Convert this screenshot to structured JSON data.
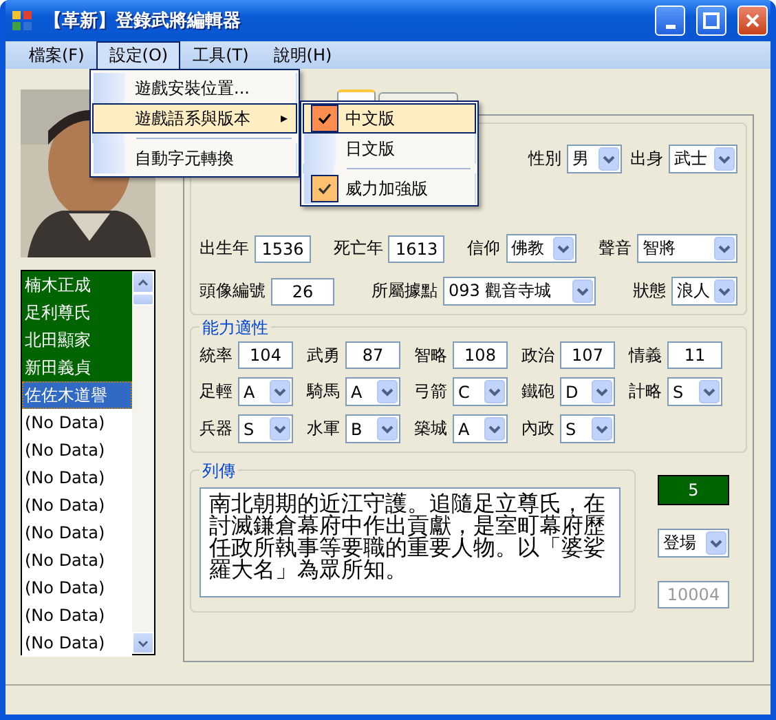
{
  "window": {
    "title": "【革新】登錄武將編輯器"
  },
  "menu": [
    {
      "label": "檔案(F)",
      "selected": false
    },
    {
      "label": "設定(O)",
      "selected": true
    },
    {
      "label": "工具(T)",
      "selected": false
    },
    {
      "label": "說明(H)",
      "selected": false
    }
  ],
  "dropdown": [
    {
      "kind": "item",
      "label": "遊戲安裝位置...",
      "selected": false
    },
    {
      "kind": "submenu",
      "label": "遊戲語系與版本",
      "arrow": "▸",
      "selected": true
    },
    {
      "kind": "separator"
    },
    {
      "kind": "item",
      "label": "自動字元轉換",
      "selected": false
    }
  ],
  "submenu": [
    {
      "kind": "item",
      "label": "中文版",
      "checked": true,
      "selected": true
    },
    {
      "kind": "item",
      "label": "日文版",
      "checked": false,
      "selected": false
    },
    {
      "kind": "separator"
    },
    {
      "kind": "item",
      "label": "威力加強版",
      "checked": true,
      "selected": false
    }
  ],
  "tabs": [
    {
      "selected": true
    },
    {
      "selected": false
    }
  ],
  "officers": [
    {
      "name": "楠木正成",
      "marked": true,
      "selected": false
    },
    {
      "name": "足利尊氏",
      "marked": true,
      "selected": false
    },
    {
      "name": "北田顯家",
      "marked": true,
      "selected": false
    },
    {
      "name": "新田義貞",
      "marked": true,
      "selected": false
    },
    {
      "name": "佐佐木道譽",
      "marked": false,
      "selected": true
    },
    {
      "name": "(No Data)",
      "marked": false,
      "selected": false
    },
    {
      "name": "(No Data)",
      "marked": false,
      "selected": false
    },
    {
      "name": "(No Data)",
      "marked": false,
      "selected": false
    },
    {
      "name": "(No Data)",
      "marked": false,
      "selected": false
    },
    {
      "name": "(No Data)",
      "marked": false,
      "selected": false
    },
    {
      "name": "(No Data)",
      "marked": false,
      "selected": false
    },
    {
      "name": "(No Data)",
      "marked": false,
      "selected": false
    },
    {
      "name": "(No Data)",
      "marked": false,
      "selected": false
    },
    {
      "name": "(No Data)",
      "marked": false,
      "selected": false
    }
  ],
  "basic": [
    [
      {
        "kind": "select",
        "label": "性別",
        "value": "男"
      },
      {
        "kind": "select",
        "label": "出身",
        "value": "武士"
      }
    ],
    [
      {
        "kind": "text",
        "label": "出生年",
        "value": "1536"
      },
      {
        "kind": "text",
        "label": "死亡年",
        "value": "1613"
      },
      {
        "kind": "select",
        "label": "信仰",
        "value": "佛教"
      },
      {
        "kind": "select",
        "label": "聲音",
        "value": "智將"
      }
    ],
    [
      {
        "kind": "text",
        "label": "頭像編號",
        "value": "26"
      },
      {
        "kind": "select",
        "label": "所屬據點",
        "value": "093 觀音寺城"
      },
      {
        "kind": "select",
        "label": "狀態",
        "value": "浪人"
      }
    ]
  ],
  "ability": {
    "title": "能力適性",
    "rows": [
      [
        {
          "kind": "text",
          "label": "統率",
          "value": "104"
        },
        {
          "kind": "text",
          "label": "武勇",
          "value": "87"
        },
        {
          "kind": "text",
          "label": "智略",
          "value": "108"
        },
        {
          "kind": "text",
          "label": "政治",
          "value": "107"
        },
        {
          "kind": "text",
          "label": "情義",
          "value": "11"
        }
      ],
      [
        {
          "kind": "select",
          "label": "足輕",
          "value": "A"
        },
        {
          "kind": "select",
          "label": "騎馬",
          "value": "A"
        },
        {
          "kind": "select",
          "label": "弓箭",
          "value": "C"
        },
        {
          "kind": "select",
          "label": "鐵砲",
          "value": "D"
        },
        {
          "kind": "select",
          "label": "計略",
          "value": "S"
        }
      ],
      [
        {
          "kind": "select",
          "label": "兵器",
          "value": "S"
        },
        {
          "kind": "select",
          "label": "水軍",
          "value": "B"
        },
        {
          "kind": "select",
          "label": "築城",
          "value": "A"
        },
        {
          "kind": "select",
          "label": "內政",
          "value": "S"
        }
      ]
    ]
  },
  "biography": {
    "title": "列傳",
    "text": "南北朝期的近江守護。追隨足立尊氏，在討滅鎌倉幕府中作出貢獻，是室町幕府歷任政所執事等要職的重要人物。以「婆娑羅大名」為眾所知。"
  },
  "side": {
    "count": "5",
    "appearance": "登場",
    "id": "10004"
  }
}
